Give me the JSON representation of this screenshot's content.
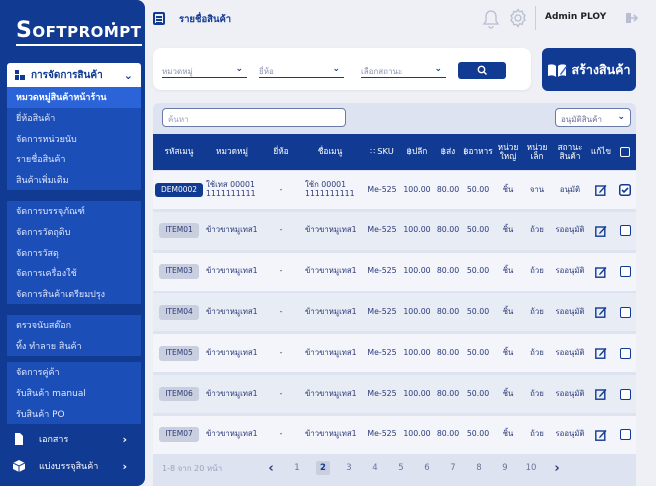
{
  "brand": {
    "logo_first": "S",
    "logo_rest": "OFTPROMPT"
  },
  "header": {
    "title": "รายชื่อสินค้า",
    "user": "Admin PLOY"
  },
  "sidebar": {
    "section_label": "การจัดการสินค้า",
    "group1": [
      "หมวดหมู่สินค้าหน้าร้าน",
      "ยี่ห้อสินค้า",
      "จัดการหน่วยนับ",
      "รายชื่อสินค้า",
      "สินค้าเพิ่มเติม"
    ],
    "group2": [
      "จัดการบรรจุภัณฑ์",
      "จัดการวัตถุดิบ",
      "จัดการวัสดุ",
      "จัดการเครื่องใช้",
      "จัดการสินค้าเตรียมปรุง"
    ],
    "group3": [
      "ตรวจนับสต๊อก",
      "ทิ้ง ทำลาย สินค้า"
    ],
    "group4": [
      "จัดการคู่ค้า",
      "รับสินค้า manual",
      "รับสินค้า PO"
    ],
    "bottom": [
      "เอกสาร",
      "แบ่งบรรจุสินค้า"
    ]
  },
  "filters": {
    "category": "หมวดหมู่",
    "brand": "ยี่ห้อ",
    "status": "เลือกสถานะ"
  },
  "create_button": "สร้างสินค้า",
  "table": {
    "search_placeholder": "ค้นหา",
    "status_filter": "อนุมัติสินค้า",
    "headers": {
      "code": "รหัสเมนู",
      "category": "หมวดหมู่",
      "brand": "ยี่ห้อ",
      "menu_name": "ชื่อเมนู",
      "sku": "SKU",
      "price_pickup": "ปลีก",
      "price_delivery": "ส่ง",
      "price_food": "อาหาร",
      "unit_big": "หน่วย ใหญ่",
      "unit_small": "หน่วย เล็ก",
      "status": "สถานะ สินค้า",
      "edit": "แก้ไข"
    },
    "rows": [
      {
        "code": "DEM0002",
        "category": "ใช้เทส 00001 1111111111",
        "brand": "-",
        "menu_name": "ใช้ก 00001 1111111111",
        "sku": "Me-525",
        "p1": "100.00",
        "p2": "80.00",
        "p3": "50.00",
        "unit_big": "ชิ้น",
        "unit_small": "จาน",
        "status": "อนุมัติ",
        "checked": true
      },
      {
        "code": "ITEM01",
        "category": "ข้าวขาหมูเทส1",
        "brand": "-",
        "menu_name": "ข้าวขาหมูเทส1",
        "sku": "Me-525",
        "p1": "100.00",
        "p2": "80.00",
        "p3": "50.00",
        "unit_big": "ชิ้น",
        "unit_small": "ถ้วย",
        "status": "รออนุมัติ",
        "checked": false
      },
      {
        "code": "ITEM03",
        "category": "ข้าวขาหมูเทส1",
        "brand": "-",
        "menu_name": "ข้าวขาหมูเทส1",
        "sku": "Me-525",
        "p1": "100.00",
        "p2": "80.00",
        "p3": "50.00",
        "unit_big": "ชิ้น",
        "unit_small": "ถ้วย",
        "status": "รออนุมัติ",
        "checked": false
      },
      {
        "code": "ITEM04",
        "category": "ข้าวขาหมูเทส1",
        "brand": "-",
        "menu_name": "ข้าวขาหมูเทส1",
        "sku": "Me-525",
        "p1": "100.00",
        "p2": "80.00",
        "p3": "50.00",
        "unit_big": "ชิ้น",
        "unit_small": "ถ้วย",
        "status": "รออนุมัติ",
        "checked": false
      },
      {
        "code": "ITEM05",
        "category": "ข้าวขาหมูเทส1",
        "brand": "-",
        "menu_name": "ข้าวขาหมูเทส1",
        "sku": "Me-525",
        "p1": "100.00",
        "p2": "80.00",
        "p3": "50.00",
        "unit_big": "ชิ้น",
        "unit_small": "ถ้วย",
        "status": "รออนุมัติ",
        "checked": false
      },
      {
        "code": "ITEM06",
        "category": "ข้าวขาหมูเทส1",
        "brand": "-",
        "menu_name": "ข้าวขาหมูเทส1",
        "sku": "Me-525",
        "p1": "100.00",
        "p2": "80.00",
        "p3": "50.00",
        "unit_big": "ชิ้น",
        "unit_small": "ถ้วย",
        "status": "รออนุมัติ",
        "checked": false
      },
      {
        "code": "ITEM07",
        "category": "ข้าวขาหมูเทส1",
        "brand": "-",
        "menu_name": "ข้าวขาหมูเทส1",
        "sku": "Me-525",
        "p1": "100.00",
        "p2": "80.00",
        "p3": "50.00",
        "unit_big": "ชิ้น",
        "unit_small": "ถ้วย",
        "status": "รออนุมัติ",
        "checked": false
      }
    ]
  },
  "pagination": {
    "info": "1-8 จาก 20 หน้า",
    "pages": [
      "1",
      "2",
      "3",
      "4",
      "5",
      "6",
      "7",
      "8",
      "9",
      "10"
    ],
    "current": "2"
  },
  "colors": {
    "primary": "#113a92",
    "sidebar_group": "#1c4eb8",
    "table_bg": "#dde3f0"
  }
}
